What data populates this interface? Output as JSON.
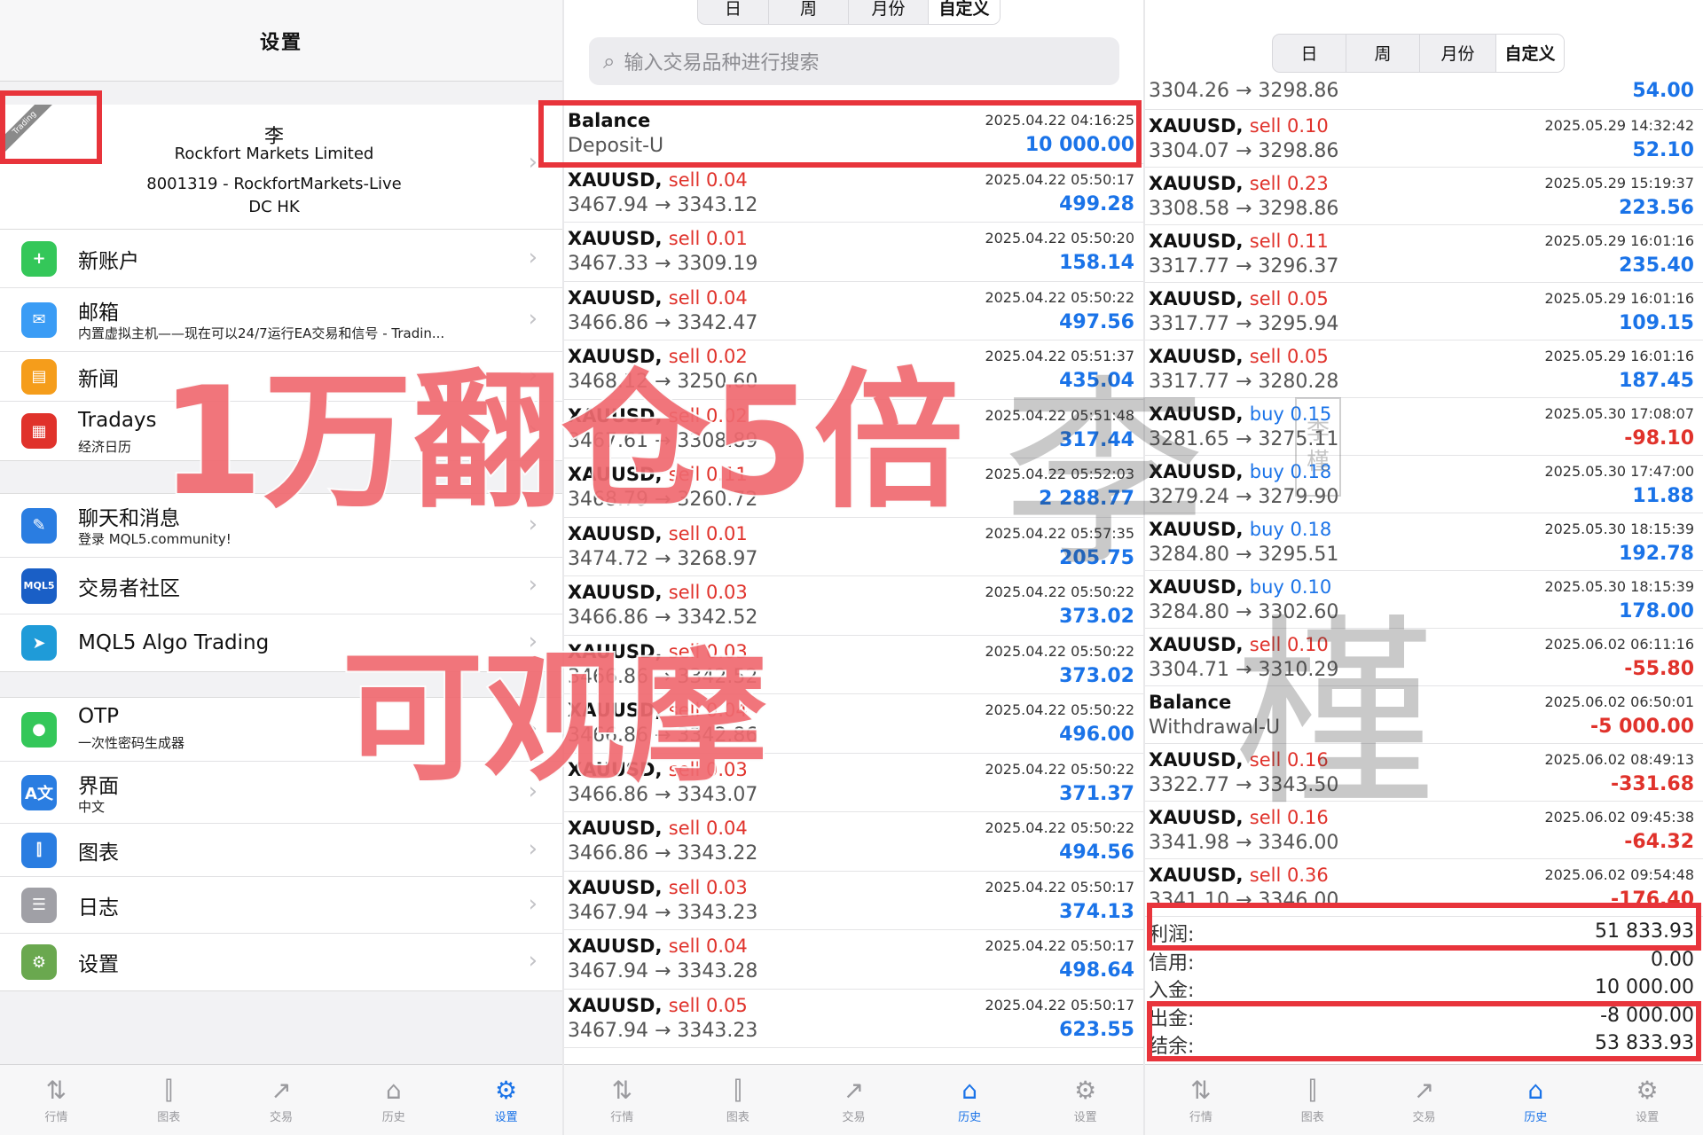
{
  "settings": {
    "title": "设置",
    "badge": "Trading",
    "account": {
      "name": "李",
      "broker": "Rockfort Markets Limited",
      "login": "8001319 - RockfortMarkets-Live",
      "region": "DC HK"
    },
    "items": [
      {
        "label": "新账户",
        "sub": "",
        "color": "#34c759",
        "glyph": "+"
      },
      {
        "label": "邮箱",
        "sub": "内置虚拟主机——现在可以24/7运行EA交易和信号 - Tradin...",
        "color": "#3a9cf5",
        "glyph": "✉"
      },
      {
        "label": "新闻",
        "sub": "",
        "color": "#f59d1b",
        "glyph": "▤"
      },
      {
        "label": "Tradays",
        "sub": "经济日历",
        "color": "#e0322b",
        "glyph": "▦"
      },
      {
        "label": "聊天和消息",
        "sub": "登录 MQL5.community!",
        "color": "#2a7de1",
        "glyph": "✎"
      },
      {
        "label": "交易者社区",
        "sub": "",
        "color": "#1a5fc6",
        "glyph": "MQL5"
      },
      {
        "label": "MQL5 Algo Trading",
        "sub": "",
        "color": "#1f9bd8",
        "glyph": "➤"
      },
      {
        "label": "OTP",
        "sub": "一次性密码生成器",
        "color": "#34c759",
        "glyph": "●"
      },
      {
        "label": "界面",
        "sub": "中文",
        "color": "#2a7de1",
        "glyph": "A文"
      },
      {
        "label": "图表",
        "sub": "",
        "color": "#2a7de1",
        "glyph": "⫿"
      },
      {
        "label": "日志",
        "sub": "",
        "color": "#a0a0a6",
        "glyph": "☰"
      },
      {
        "label": "设置",
        "sub": "",
        "color": "#6aa84f",
        "glyph": "⚙"
      }
    ]
  },
  "tabs": [
    {
      "label": "行情",
      "icon": "⇅"
    },
    {
      "label": "图表",
      "icon": "⫿"
    },
    {
      "label": "交易",
      "icon": "↗"
    },
    {
      "label": "历史",
      "icon": "⌂"
    },
    {
      "label": "设置",
      "icon": "⚙"
    }
  ],
  "period_tabs": [
    "日",
    "周",
    "月份",
    "自定义"
  ],
  "search_placeholder": "输入交易品种进行搜索",
  "history_left": [
    {
      "sym": "Balance",
      "side": "",
      "vol": "",
      "time": "2025.04.22 04:16:25",
      "price": "Deposit-U",
      "profit": "10 000.00",
      "neg": false
    },
    {
      "sym": "XAUUSD,",
      "side": "sell",
      "vol": "0.04",
      "time": "2025.04.22 05:50:17",
      "price": "3467.94 → 3343.12",
      "profit": "499.28",
      "neg": false
    },
    {
      "sym": "XAUUSD,",
      "side": "sell",
      "vol": "0.01",
      "time": "2025.04.22 05:50:20",
      "price": "3467.33 → 3309.19",
      "profit": "158.14",
      "neg": false
    },
    {
      "sym": "XAUUSD,",
      "side": "sell",
      "vol": "0.04",
      "time": "2025.04.22 05:50:22",
      "price": "3466.86 → 3342.47",
      "profit": "497.56",
      "neg": false
    },
    {
      "sym": "XAUUSD,",
      "side": "sell",
      "vol": "0.02",
      "time": "2025.04.22 05:51:37",
      "price": "3468.12 → 3250.60",
      "profit": "435.04",
      "neg": false
    },
    {
      "sym": "XAUUSD,",
      "side": "sell",
      "vol": "0.02",
      "time": "2025.04.22 05:51:48",
      "price": "3467.61 → 3308.89",
      "profit": "317.44",
      "neg": false
    },
    {
      "sym": "XAUUSD,",
      "side": "sell",
      "vol": "0.11",
      "time": "2025.04.22 05:52:03",
      "price": "3468.79 → 3260.72",
      "profit": "2 288.77",
      "neg": false
    },
    {
      "sym": "XAUUSD,",
      "side": "sell",
      "vol": "0.01",
      "time": "2025.04.22 05:57:35",
      "price": "3474.72 → 3268.97",
      "profit": "205.75",
      "neg": false
    },
    {
      "sym": "XAUUSD,",
      "side": "sell",
      "vol": "0.03",
      "time": "2025.04.22 05:50:22",
      "price": "3466.86 → 3342.52",
      "profit": "373.02",
      "neg": false
    },
    {
      "sym": "XAUUSD,",
      "side": "sell",
      "vol": "0.03",
      "time": "2025.04.22 05:50:22",
      "price": "3466.86 → 3342.52",
      "profit": "373.02",
      "neg": false
    },
    {
      "sym": "XAUUSD,",
      "side": "sell",
      "vol": "0.04",
      "time": "2025.04.22 05:50:22",
      "price": "3466.86 → 3342.86",
      "profit": "496.00",
      "neg": false
    },
    {
      "sym": "XAUUSD,",
      "side": "sell",
      "vol": "0.03",
      "time": "2025.04.22 05:50:22",
      "price": "3466.86 → 3343.07",
      "profit": "371.37",
      "neg": false
    },
    {
      "sym": "XAUUSD,",
      "side": "sell",
      "vol": "0.04",
      "time": "2025.04.22 05:50:22",
      "price": "3466.86 → 3343.22",
      "profit": "494.56",
      "neg": false
    },
    {
      "sym": "XAUUSD,",
      "side": "sell",
      "vol": "0.03",
      "time": "2025.04.22 05:50:17",
      "price": "3467.94 → 3343.23",
      "profit": "374.13",
      "neg": false
    },
    {
      "sym": "XAUUSD,",
      "side": "sell",
      "vol": "0.04",
      "time": "2025.04.22 05:50:17",
      "price": "3467.94 → 3343.28",
      "profit": "498.64",
      "neg": false
    },
    {
      "sym": "XAUUSD,",
      "side": "sell",
      "vol": "0.05",
      "time": "2025.04.22 05:50:17",
      "price": "3467.94 → 3343.23",
      "profit": "623.55",
      "neg": false
    }
  ],
  "history_right_top": {
    "price": "3304.26 → 3298.86",
    "profit": "54.00"
  },
  "history_right": [
    {
      "sym": "XAUUSD,",
      "side": "sell",
      "vol": "0.10",
      "time": "2025.05.29 14:32:42",
      "price": "3304.07 → 3298.86",
      "profit": "52.10",
      "neg": false
    },
    {
      "sym": "XAUUSD,",
      "side": "sell",
      "vol": "0.23",
      "time": "2025.05.29 15:19:37",
      "price": "3308.58 → 3298.86",
      "profit": "223.56",
      "neg": false
    },
    {
      "sym": "XAUUSD,",
      "side": "sell",
      "vol": "0.11",
      "time": "2025.05.29 16:01:16",
      "price": "3317.77 → 3296.37",
      "profit": "235.40",
      "neg": false
    },
    {
      "sym": "XAUUSD,",
      "side": "sell",
      "vol": "0.05",
      "time": "2025.05.29 16:01:16",
      "price": "3317.77 → 3295.94",
      "profit": "109.15",
      "neg": false
    },
    {
      "sym": "XAUUSD,",
      "side": "sell",
      "vol": "0.05",
      "time": "2025.05.29 16:01:16",
      "price": "3317.77 → 3280.28",
      "profit": "187.45",
      "neg": false
    },
    {
      "sym": "XAUUSD,",
      "side": "buy",
      "vol": "0.15",
      "time": "2025.05.30 17:08:07",
      "price": "3281.65 → 3275.11",
      "profit": "-98.10",
      "neg": true
    },
    {
      "sym": "XAUUSD,",
      "side": "buy",
      "vol": "0.18",
      "time": "2025.05.30 17:47:00",
      "price": "3279.24 → 3279.90",
      "profit": "11.88",
      "neg": false
    },
    {
      "sym": "XAUUSD,",
      "side": "buy",
      "vol": "0.18",
      "time": "2025.05.30 18:15:39",
      "price": "3284.80 → 3295.51",
      "profit": "192.78",
      "neg": false
    },
    {
      "sym": "XAUUSD,",
      "side": "buy",
      "vol": "0.10",
      "time": "2025.05.30 18:15:39",
      "price": "3284.80 → 3302.60",
      "profit": "178.00",
      "neg": false
    },
    {
      "sym": "XAUUSD,",
      "side": "sell",
      "vol": "0.10",
      "time": "2025.06.02 06:11:16",
      "price": "3304.71 → 3310.29",
      "profit": "-55.80",
      "neg": true
    },
    {
      "sym": "Balance",
      "side": "",
      "vol": "",
      "time": "2025.06.02 06:50:01",
      "price": "Withdrawal-U",
      "profit": "-5 000.00",
      "neg": true
    },
    {
      "sym": "XAUUSD,",
      "side": "sell",
      "vol": "0.16",
      "time": "2025.06.02 08:49:13",
      "price": "3322.77 → 3343.50",
      "profit": "-331.68",
      "neg": true
    },
    {
      "sym": "XAUUSD,",
      "side": "sell",
      "vol": "0.16",
      "time": "2025.06.02 09:45:38",
      "price": "3341.98 → 3346.00",
      "profit": "-64.32",
      "neg": true
    },
    {
      "sym": "XAUUSD,",
      "side": "sell",
      "vol": "0.36",
      "time": "2025.06.02 09:54:48",
      "price": "3341.10 → 3346.00",
      "profit": "-176.40",
      "neg": true
    }
  ],
  "summary": [
    {
      "k": "利润:",
      "v": "51 833.93"
    },
    {
      "k": "信用:",
      "v": "0.00"
    },
    {
      "k": "入金:",
      "v": "10 000.00"
    },
    {
      "k": "出金:",
      "v": "-8 000.00"
    },
    {
      "k": "结余:",
      "v": "53 833.93"
    }
  ],
  "overlay": {
    "line1": "1万翻仓5倍",
    "line2": "可观摩",
    "watermark": "李槿",
    "seal_chars": [
      "李",
      "槿"
    ]
  },
  "colors": {
    "sell": "#e0322b",
    "buy": "#1a73e8",
    "accent": "#1a73e8",
    "highlight": "#e8343b",
    "overlay": "#f06a70"
  }
}
